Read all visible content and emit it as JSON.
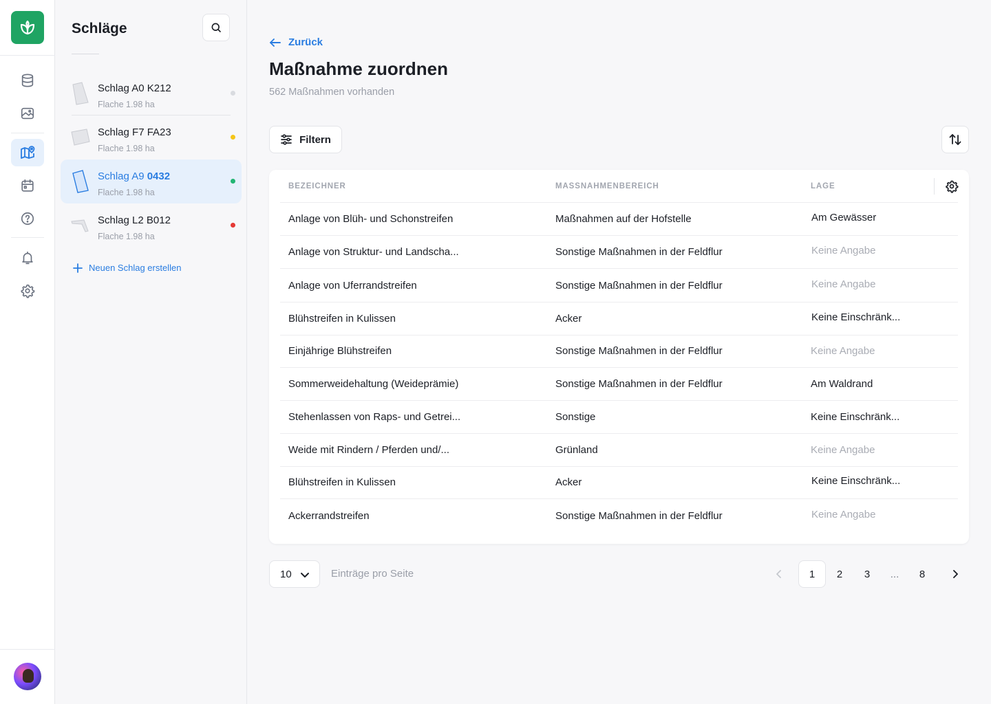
{
  "rail": {
    "items": [
      {
        "name": "database-icon",
        "active": false
      },
      {
        "name": "image-icon",
        "active": false
      },
      {
        "name": "map-pin-icon",
        "active": true
      },
      {
        "name": "calendar-icon",
        "active": false
      },
      {
        "name": "help-icon",
        "active": false
      },
      {
        "name": "bell-icon",
        "active": false
      },
      {
        "name": "settings-icon",
        "active": false
      }
    ]
  },
  "panel": {
    "title": "Schläge",
    "fields": [
      {
        "name": "Schlag A0 K212",
        "name_prefix": "Schlag A0 K212",
        "name_bold": "",
        "area": "Flache 1.98 ha",
        "status_color": "#d9dbe0",
        "active": false
      },
      {
        "name": "Schlag F7 FA23",
        "name_prefix": "Schlag F7 FA23",
        "name_bold": "",
        "area": "Flache 1.98 ha",
        "status_color": "#f5c518",
        "active": false
      },
      {
        "name": "Schlag A9 0432",
        "name_prefix": "Schlag A9 ",
        "name_bold": "0432",
        "area": "Flache 1.98 ha",
        "status_color": "#22b573",
        "active": true
      },
      {
        "name": "Schlag L2 B012",
        "name_prefix": "Schlag L2 B012",
        "name_bold": "",
        "area": "Flache 1.98 ha",
        "status_color": "#e53935",
        "active": false
      }
    ],
    "new_field_label": "Neuen Schlag erstellen"
  },
  "main": {
    "back_label": "Zurück",
    "title": "Maßnahme zuordnen",
    "subtitle": "562 Maßnahmen vorhanden",
    "filter_label": "Filtern",
    "table": {
      "headers": [
        "BEZEICHNER",
        "MASSNAHMENBEREICH",
        "LAGE"
      ],
      "rows": [
        {
          "name": "Anlage von Blüh- und Schonstreifen",
          "area": "Maßnahmen auf der Hofstelle",
          "location": "Am Gewässer",
          "location_muted": false
        },
        {
          "name": "Anlage von Struktur- und Landscha...",
          "area": "Sonstige Maßnahmen in der Feldflur",
          "location": "Keine Angabe",
          "location_muted": true
        },
        {
          "name": "Anlage von Uferrandstreifen",
          "area": "Sonstige Maßnahmen in der Feldflur",
          "location": "Keine Angabe",
          "location_muted": true
        },
        {
          "name": "Blühstreifen in Kulissen",
          "area": "Acker",
          "location": "Keine Einschränk...",
          "location_muted": false
        },
        {
          "name": "Einjährige Blühstreifen",
          "area": "Sonstige Maßnahmen in der Feldflur",
          "location": "Keine Angabe",
          "location_muted": true
        },
        {
          "name": "Sommerweidehaltung (Weideprämie)",
          "area": "Sonstige Maßnahmen in der Feldflur",
          "location": "Am Waldrand",
          "location_muted": false
        },
        {
          "name": "Stehenlassen von Raps- und Getrei...",
          "area": "Sonstige",
          "location": "Keine Einschränk...",
          "location_muted": false
        },
        {
          "name": "Weide mit Rindern / Pferden und/...",
          "area": "Grünland",
          "location": "Keine Angabe",
          "location_muted": true
        },
        {
          "name": "Blühstreifen in Kulissen",
          "area": "Acker",
          "location": "Keine Einschränk...",
          "location_muted": false
        },
        {
          "name": "Ackerrandstreifen",
          "area": "Sonstige Maßnahmen in der Feldflur",
          "location": "Keine Angabe",
          "location_muted": true
        }
      ]
    },
    "pagination": {
      "per_page_value": "10",
      "per_page_label": "Einträge pro Seite",
      "pages": [
        "1",
        "2",
        "3",
        "...",
        "8"
      ],
      "current_page": "1"
    }
  },
  "colors": {
    "accent": "#2a7de1",
    "brand": "#1fa463"
  }
}
